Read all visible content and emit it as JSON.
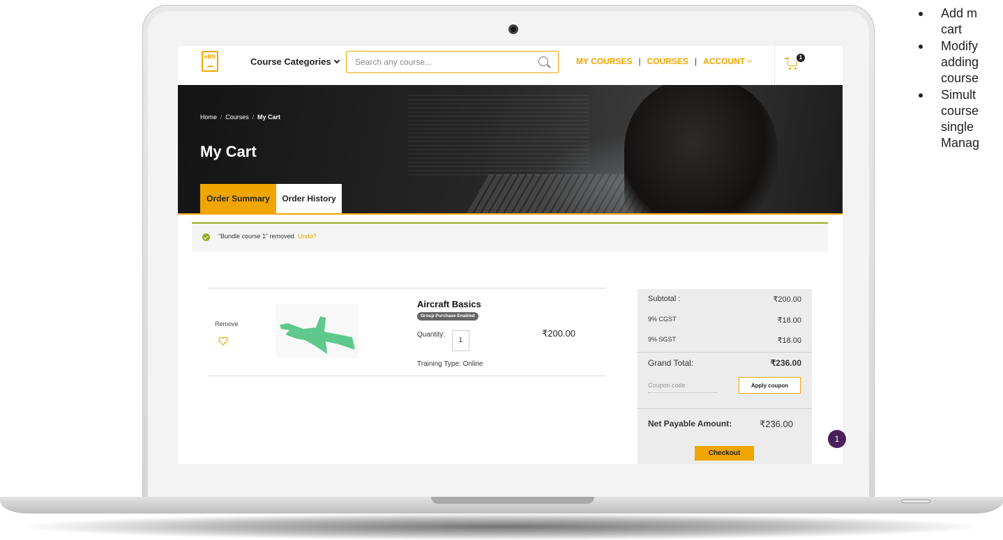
{
  "header": {
    "logo_text": "eBN",
    "course_categories": "Course Categories",
    "search_placeholder": "Search any course...",
    "nav": {
      "my_courses": "MY COURSES",
      "courses": "COURSES",
      "account": "ACCOUNT",
      "separator": "|"
    },
    "cart_count": "1"
  },
  "breadcrumb": {
    "home": "Home",
    "courses": "Courses",
    "current": "My Cart",
    "separator": "/"
  },
  "page_title": "My Cart",
  "tabs": {
    "order_summary": "Order Summary",
    "order_history": "Order History"
  },
  "notice": {
    "message": "“Bundle course 1” removed.",
    "undo": "Undo?"
  },
  "cart_item": {
    "remove": "Remove",
    "name": "Aircraft Basics",
    "badge": "Group Purchase Enabled",
    "quantity_label": "Quantity:",
    "quantity": "1",
    "price": "₹200.00",
    "training_type": "Training Type: Online"
  },
  "summary": {
    "subtotal_label": "Subtotal :",
    "subtotal": "₹200.00",
    "cgst_label": "9% CGST",
    "cgst": "₹18.00",
    "sgst_label": "9% SGST",
    "sgst": "₹18.00",
    "grand_total_label": "Grand Total:",
    "grand_total": "₹236.00",
    "coupon_placeholder": "Coupon code",
    "apply_coupon": "Apply coupon",
    "net_payable_label": "Net Payable Amount:",
    "net_payable": "₹236.00",
    "checkout": "Checkout"
  },
  "chat_badge": "1",
  "side_bullets": [
    [
      "Add m",
      "cart"
    ],
    [
      "Modify",
      "adding",
      "course"
    ],
    [
      "Simult",
      "course",
      "single",
      "Manag"
    ]
  ],
  "colors": {
    "accent": "#f0a500",
    "success": "#8fae1b",
    "plane": "#5ec98a",
    "chat": "#4a1f5c"
  },
  "icons": [
    "search-icon",
    "chevron-down-icon",
    "cart-icon",
    "check-circle-icon",
    "heart-icon",
    "airplane-image"
  ]
}
